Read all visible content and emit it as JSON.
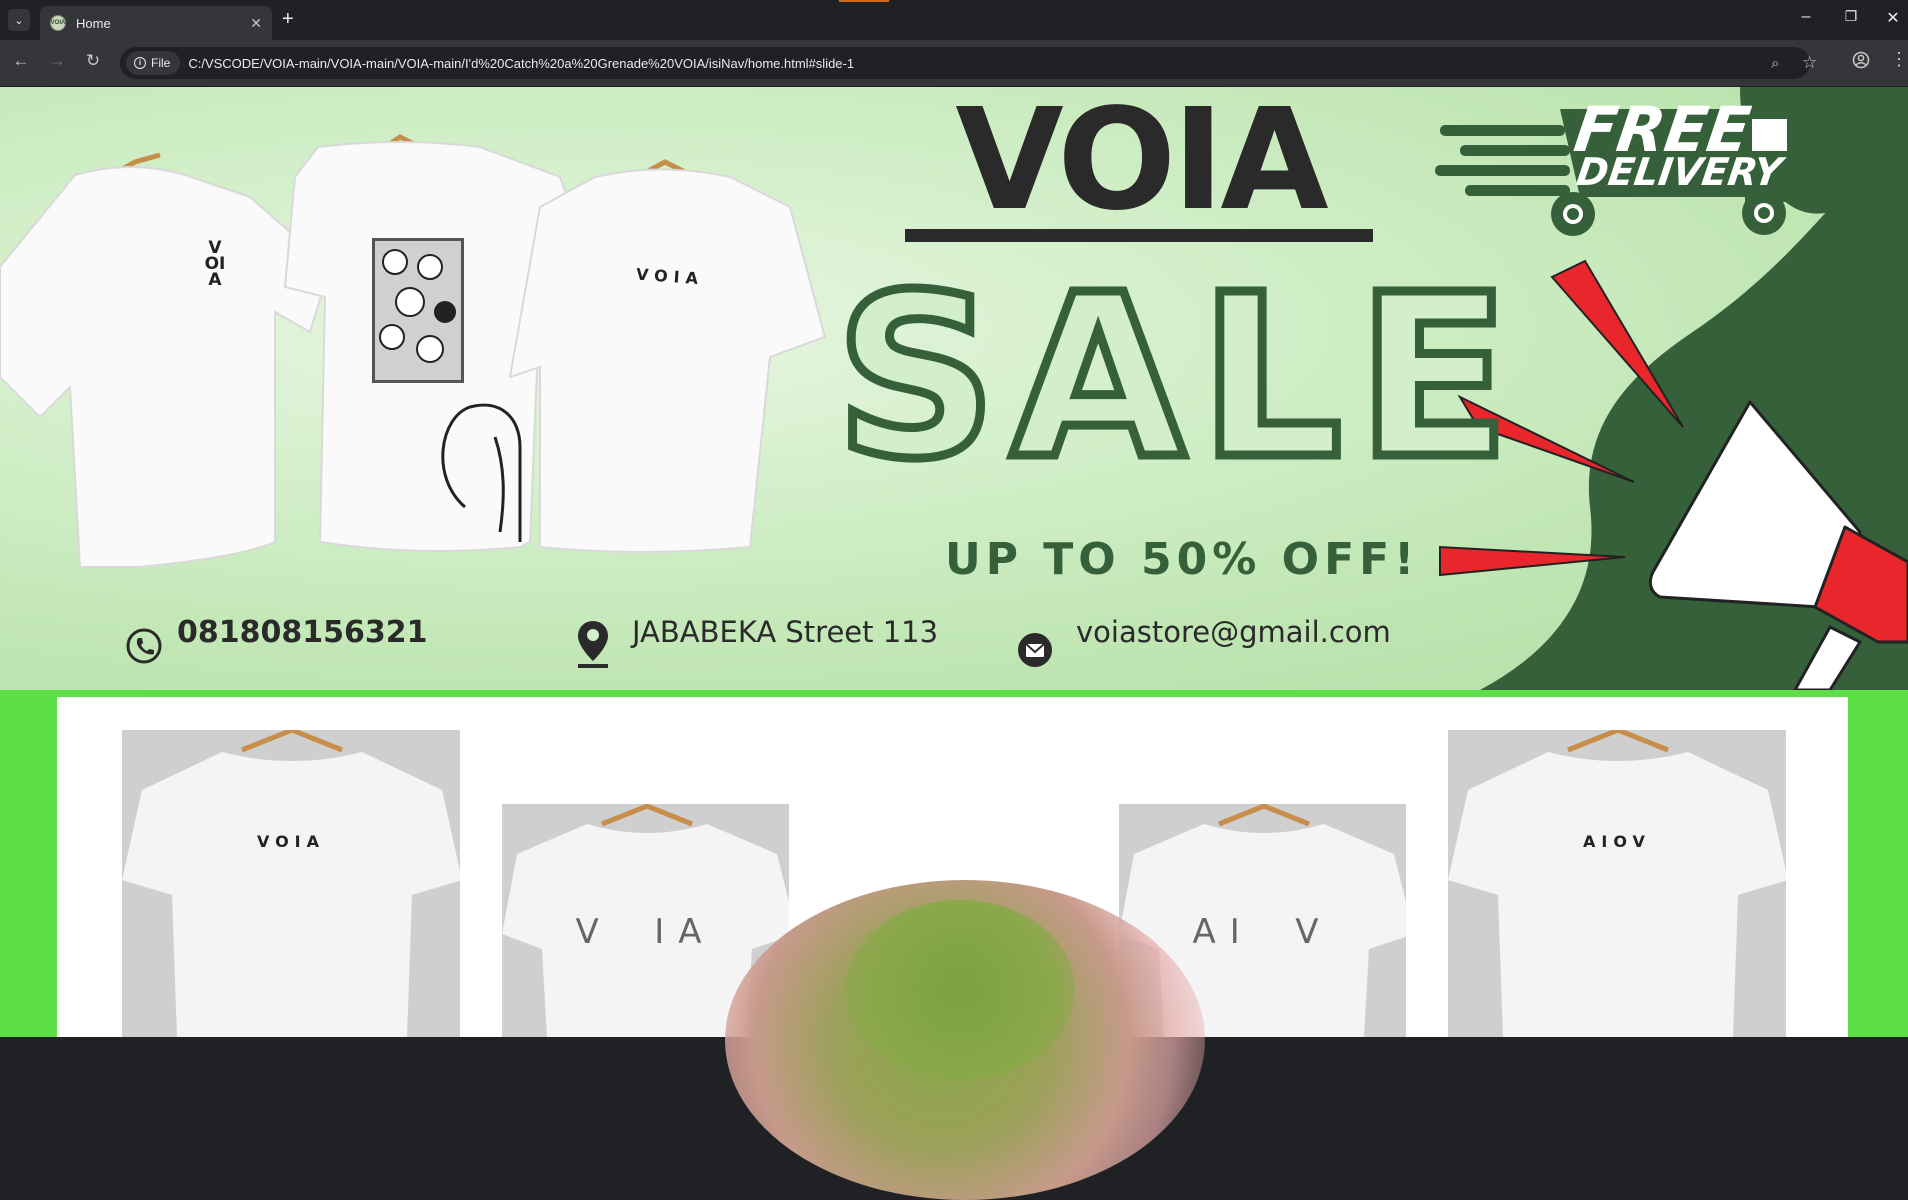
{
  "browser": {
    "tab": {
      "title": "Home"
    },
    "new_tab": "+",
    "controls": {
      "minimize": "–",
      "restore": "❐",
      "close": "✕"
    },
    "site_chip": "File",
    "url": "C:/VSCODE/VOIA-main/VOIA-main/VOIA-main/I'd%20Catch%20a%20Grenade%20VOIA/isiNav/home.html#slide-1"
  },
  "hero": {
    "brand": "VOIA",
    "free": "FREE",
    "delivery": "DELIVERY",
    "sale": "SALE",
    "discount": "UP TO 50% OFF!",
    "shirt_texts": [
      "V",
      "OI",
      "A",
      "VOIA"
    ],
    "contacts": {
      "phone": "081808156321",
      "address": "JABABEKA Street 113",
      "email": "voiastore@gmail.com"
    }
  },
  "products": [
    {
      "label": "VOIA"
    },
    {
      "label": "V  IA"
    },
    {
      "label": "AI  V"
    },
    {
      "label": "AIOV"
    }
  ],
  "colors": {
    "hero_green": "#35603a",
    "hero_bg": "#d2efc9",
    "section_bg": "#5ddf46",
    "megaphone_red": "#e8262b"
  }
}
